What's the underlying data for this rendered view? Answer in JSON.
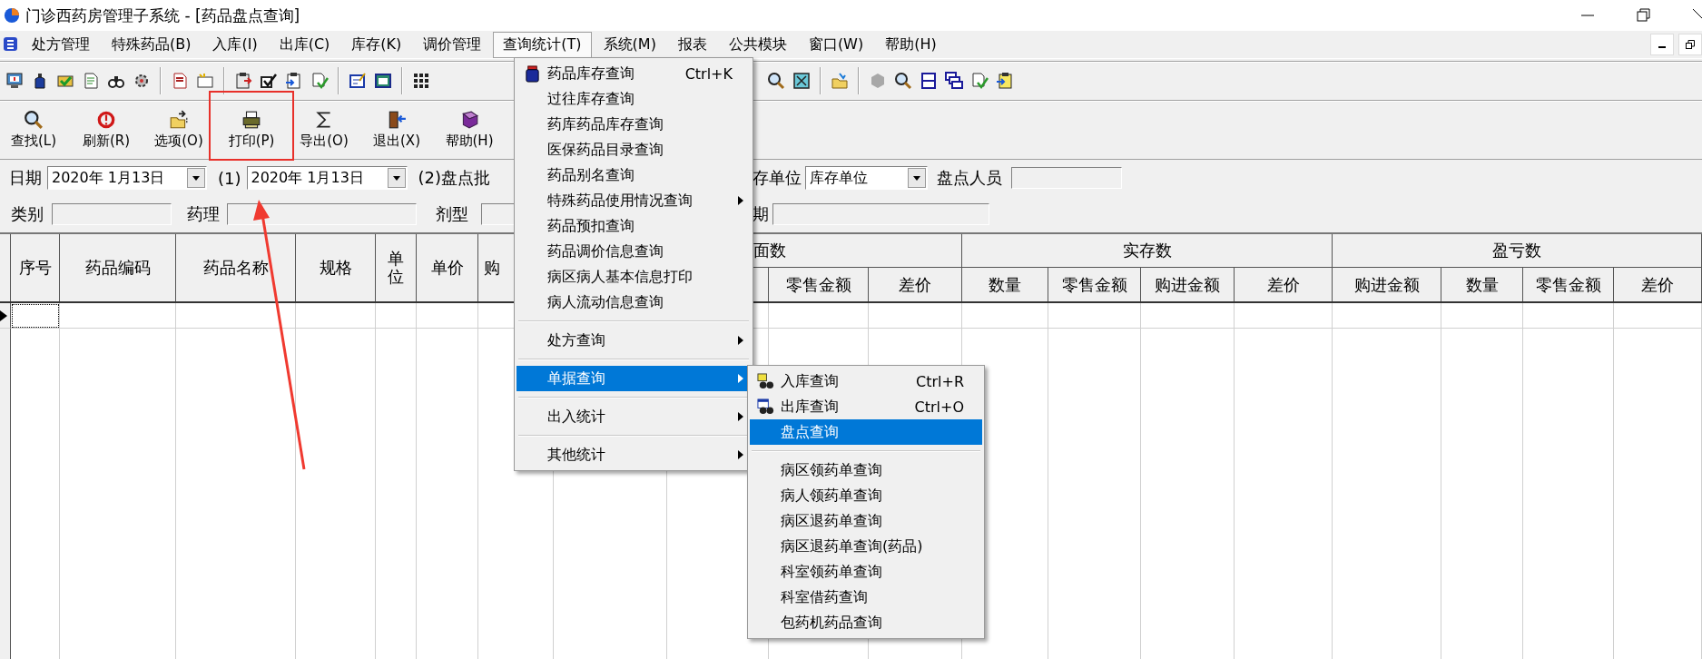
{
  "window": {
    "title": "门诊西药房管理子系统 - [药品盘点查询]"
  },
  "menu_bar": [
    {
      "label": "处方管理",
      "selected": false
    },
    {
      "label": "特殊药品(B)",
      "selected": false
    },
    {
      "label": "入库(I)",
      "selected": false
    },
    {
      "label": "出库(C)",
      "selected": false
    },
    {
      "label": "库存(K)",
      "selected": false
    },
    {
      "label": "调价管理",
      "selected": false
    },
    {
      "label": "查询统计(T)",
      "selected": true
    },
    {
      "label": "系统(M)",
      "selected": false
    },
    {
      "label": "报表",
      "selected": false
    },
    {
      "label": "公共模块",
      "selected": false
    },
    {
      "label": "窗口(W)",
      "selected": false
    },
    {
      "label": "帮助(H)",
      "selected": false
    }
  ],
  "toolbar_buttons": [
    {
      "label": "查找(L)"
    },
    {
      "label": "刷新(R)"
    },
    {
      "label": "选项(O)"
    },
    {
      "label": "打印(P)"
    },
    {
      "label": "导出(O)"
    },
    {
      "label": "退出(X)"
    },
    {
      "label": "帮助(H)"
    }
  ],
  "filters": {
    "date_label": "日期",
    "date_from": "2020年 1月13日",
    "range_1": "(1)",
    "date_to": "2020年 1月13日",
    "batch_label": "(2)盘点批",
    "unit_label": "存单位",
    "unit_value": "库存单位",
    "counter_label": "盘点人员",
    "category_label": "类别",
    "pharmacology_label": "药理",
    "dosage_label": "剂型",
    "period_label": "期"
  },
  "table": {
    "columns": [
      {
        "label": "序号"
      },
      {
        "label": "药品编码"
      },
      {
        "label": "药品名称"
      },
      {
        "label": "规格"
      },
      {
        "label": "单位"
      },
      {
        "label": "单价"
      },
      {
        "label": "购"
      }
    ],
    "groups": [
      {
        "label": "面数",
        "columns": [
          {
            "label": "零售金额"
          },
          {
            "label": "差价"
          }
        ]
      },
      {
        "label": "实存数",
        "columns": [
          {
            "label": "数量"
          },
          {
            "label": "零售金额"
          },
          {
            "label": "购进金额"
          },
          {
            "label": "差价"
          }
        ]
      },
      {
        "label": "盈亏数",
        "columns": [
          {
            "label": "购进金额"
          },
          {
            "label": "数量"
          },
          {
            "label": "零售金额"
          },
          {
            "label": "差价"
          }
        ]
      }
    ],
    "rows": [
      {
        "selected": true
      }
    ]
  },
  "query_menu": {
    "items": [
      {
        "kind": "item",
        "label": "药品库存查询",
        "shortcut": "Ctrl+K",
        "submenu": false,
        "selected": false
      },
      {
        "kind": "item",
        "label": "过往库存查询",
        "submenu": false,
        "selected": false
      },
      {
        "kind": "item",
        "label": "药库药品库存查询",
        "submenu": false,
        "selected": false
      },
      {
        "kind": "item",
        "label": "医保药品目录查询",
        "submenu": false,
        "selected": false
      },
      {
        "kind": "item",
        "label": "药品别名查询",
        "submenu": false,
        "selected": false
      },
      {
        "kind": "item",
        "label": "特殊药品使用情况查询",
        "submenu": true,
        "selected": false
      },
      {
        "kind": "item",
        "label": "药品预扣查询",
        "submenu": false,
        "selected": false
      },
      {
        "kind": "item",
        "label": "药品调价信息查询",
        "submenu": false,
        "selected": false
      },
      {
        "kind": "item",
        "label": "病区病人基本信息打印",
        "submenu": false,
        "selected": false
      },
      {
        "kind": "item",
        "label": "病人流动信息查询",
        "submenu": false,
        "selected": false
      },
      {
        "kind": "separator"
      },
      {
        "kind": "item",
        "label": "处方查询",
        "submenu": true,
        "selected": false
      },
      {
        "kind": "separator"
      },
      {
        "kind": "item",
        "label": "单据查询",
        "submenu": true,
        "selected": true
      },
      {
        "kind": "separator"
      },
      {
        "kind": "item",
        "label": "出入统计",
        "submenu": true,
        "selected": false
      },
      {
        "kind": "separator"
      },
      {
        "kind": "item",
        "label": "其他统计",
        "submenu": true,
        "selected": false
      }
    ]
  },
  "voucher_submenu": {
    "items": [
      {
        "kind": "item",
        "label": "入库查询",
        "shortcut": "Ctrl+R",
        "submenu": false,
        "selected": false
      },
      {
        "kind": "item",
        "label": "出库查询",
        "shortcut": "Ctrl+O",
        "submenu": false,
        "selected": false
      },
      {
        "kind": "item",
        "label": "盘点查询",
        "submenu": false,
        "selected": true
      },
      {
        "kind": "separator"
      },
      {
        "kind": "item",
        "label": "病区领药单查询",
        "submenu": false,
        "selected": false
      },
      {
        "kind": "item",
        "label": "病人领药单查询",
        "submenu": false,
        "selected": false
      },
      {
        "kind": "item",
        "label": "病区退药单查询",
        "submenu": false,
        "selected": false
      },
      {
        "kind": "item",
        "label": "病区退药单查询(药品)",
        "submenu": false,
        "selected": false
      },
      {
        "kind": "item",
        "label": "科室领药单查询",
        "submenu": false,
        "selected": false
      },
      {
        "kind": "item",
        "label": "科室借药查询",
        "submenu": false,
        "selected": false
      },
      {
        "kind": "item",
        "label": "包药机药品查询",
        "submenu": false,
        "selected": false
      }
    ]
  }
}
